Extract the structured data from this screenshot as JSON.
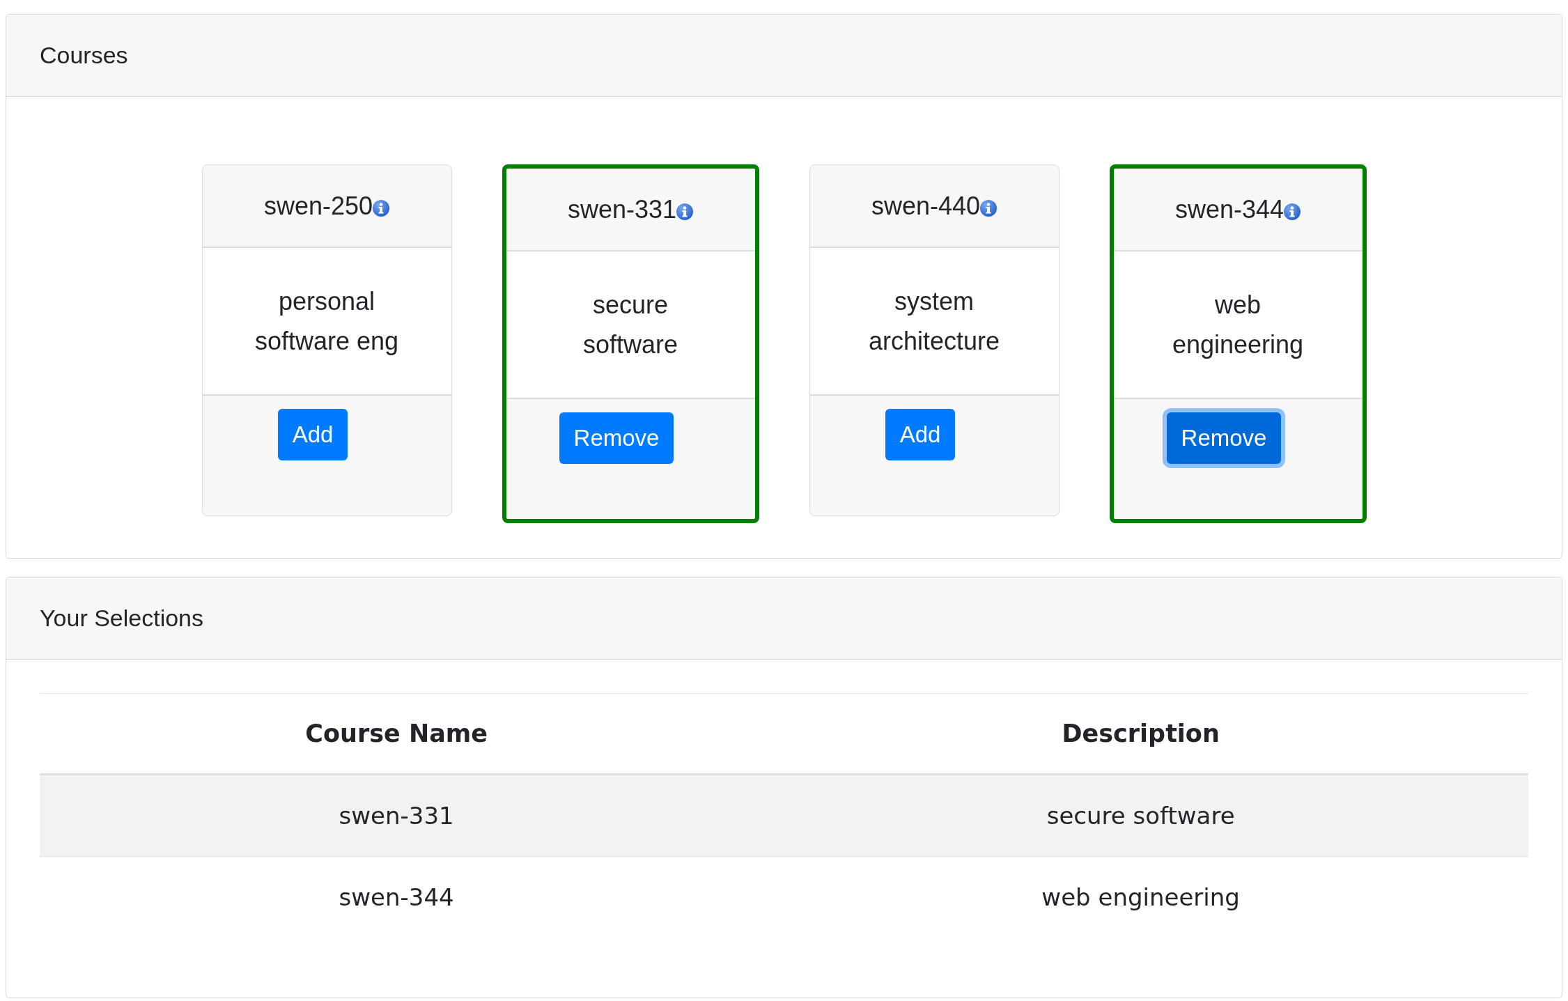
{
  "courses_panel": {
    "title": "Courses",
    "courses": [
      {
        "code": "swen-250",
        "description": "personal software eng",
        "selected": false,
        "button": {
          "label": "Add",
          "focused": false
        }
      },
      {
        "code": "swen-331",
        "description": "secure software",
        "selected": true,
        "button": {
          "label": "Remove",
          "focused": false
        }
      },
      {
        "code": "swen-440",
        "description": "system architecture",
        "selected": false,
        "button": {
          "label": "Add",
          "focused": false
        }
      },
      {
        "code": "swen-344",
        "description": "web engineering",
        "selected": true,
        "button": {
          "label": "Remove",
          "focused": true
        }
      }
    ]
  },
  "selections_panel": {
    "title": "Your Selections",
    "table": {
      "columns": [
        "Course Name",
        "Description"
      ],
      "rows": [
        [
          "swen-331",
          "secure software"
        ],
        [
          "swen-344",
          "web engineering"
        ]
      ]
    }
  }
}
